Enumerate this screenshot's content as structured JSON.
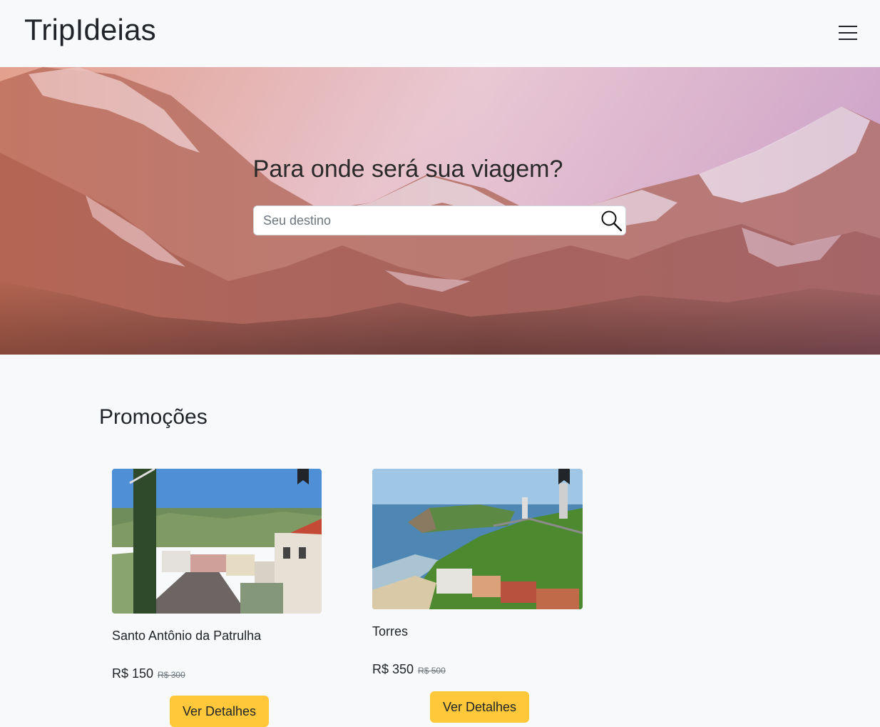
{
  "navbar": {
    "brand": "TripIdeias",
    "menu_icon": "hamburger-menu-icon"
  },
  "hero": {
    "title": "Para onde será sua viagem?",
    "search_placeholder": "Seu destino",
    "search_value": "",
    "search_icon": "search-icon"
  },
  "promotions": {
    "title": "Promoções",
    "items": [
      {
        "name": "Santo Antônio da Patrulha",
        "price": "R$ 150",
        "old_price": "R$ 300",
        "button": "Ver Detalhes",
        "bookmark_icon": "bookmark-icon"
      },
      {
        "name": "Torres",
        "price": "R$ 350",
        "old_price": "R$ 500",
        "button": "Ver Detalhes",
        "bookmark_icon": "bookmark-icon"
      }
    ]
  },
  "colors": {
    "background": "#f8f9fa",
    "button": "#ffc73a",
    "text": "#212529"
  }
}
